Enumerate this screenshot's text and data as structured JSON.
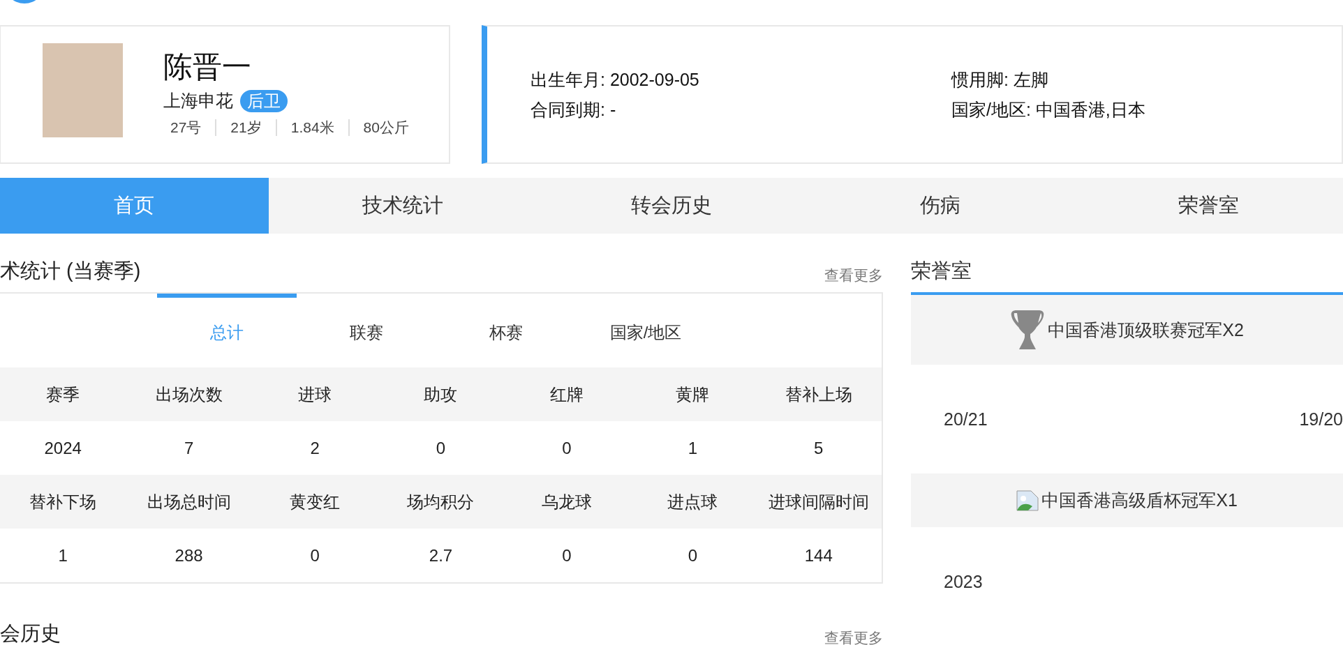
{
  "player": {
    "name": "陈晋一",
    "team": "上海申花",
    "position": "后卫",
    "stats": [
      "27号",
      "21岁",
      "1.84米",
      "80公斤"
    ]
  },
  "info": [
    "出生年月: 2002-09-05",
    "惯用脚: 左脚",
    "合同到期: -",
    "国家/地区: 中国香港,日本"
  ],
  "tabs": [
    {
      "label": "首页",
      "selected": true
    },
    {
      "label": "技术统计",
      "selected": false
    },
    {
      "label": "转会历史",
      "selected": false
    },
    {
      "label": "伤病",
      "selected": false
    },
    {
      "label": "荣誉室",
      "selected": false
    }
  ],
  "stats_section": {
    "title": "术统计 (当赛季)",
    "more": "查看更多",
    "subtabs": [
      {
        "label": "总计",
        "selected": true
      },
      {
        "label": "联赛",
        "selected": false
      },
      {
        "label": "杯赛",
        "selected": false
      },
      {
        "label": "国家/地区",
        "selected": false
      }
    ],
    "rows": [
      {
        "kind": "header",
        "cells": [
          "赛季",
          "出场次数",
          "进球",
          "助攻",
          "红牌",
          "黄牌",
          "替补上场"
        ]
      },
      {
        "kind": "data",
        "cells": [
          "2024",
          "7",
          "2",
          "0",
          "0",
          "1",
          "5"
        ]
      },
      {
        "kind": "header",
        "cells": [
          "替补下场",
          "出场总时间",
          "黄变红",
          "场均积分",
          "乌龙球",
          "进点球",
          "进球间隔时间"
        ]
      },
      {
        "kind": "data",
        "cells": [
          "1",
          "288",
          "0",
          "2.7",
          "0",
          "0",
          "144"
        ]
      }
    ]
  },
  "transfer_section": {
    "title": "会历史",
    "more": "查看更多"
  },
  "honors": {
    "title": "荣誉室",
    "items": [
      {
        "kind": "trophy",
        "title": "中国香港顶级联赛冠军X2",
        "years": [
          "20/21",
          "19/20"
        ]
      },
      {
        "kind": "broken",
        "title": "中国香港高级盾杯冠军X1",
        "years": [
          "2023"
        ]
      }
    ]
  }
}
